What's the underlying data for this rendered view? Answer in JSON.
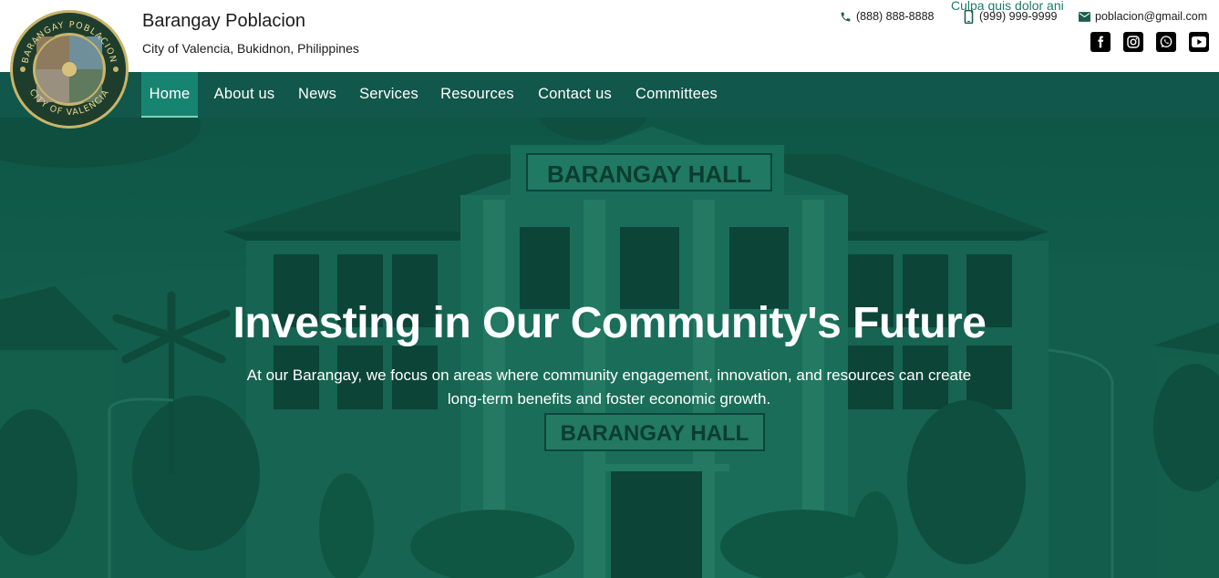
{
  "header": {
    "title": "Barangay Poblacion",
    "subtitle": "City of Valencia, Bukidnon, Philippines",
    "tagline": "Culpa quis dolor ani",
    "logo": {
      "ring_text_top": "BARANGAY POBLACION",
      "ring_text_bottom": "CITY OF VALENCIA"
    },
    "contacts": [
      {
        "icon": "phone-icon",
        "text": "(888) 888-8888"
      },
      {
        "icon": "mobile-phone-icon",
        "text": "(999) 999-9999"
      },
      {
        "icon": "envelope-icon",
        "text": "poblacion@gmail.com"
      }
    ],
    "social": [
      "facebook-icon",
      "instagram-icon",
      "whatsapp-icon",
      "youtube-icon"
    ]
  },
  "nav": {
    "items": [
      {
        "label": "Home",
        "active": true
      },
      {
        "label": "About us"
      },
      {
        "label": "News"
      },
      {
        "label": "Services"
      },
      {
        "label": "Resources"
      },
      {
        "label": "Contact us"
      },
      {
        "label": "Committees"
      }
    ]
  },
  "hero": {
    "title": "Investing in Our Community's Future",
    "text": "At our Barangay, we focus on areas where community engagement, innovation, and resources can create long-term benefits and foster economic growth.",
    "building_sign_top": "BARANGAY HALL",
    "building_sign_bottom": "BARANGAY HALL"
  },
  "colors": {
    "nav_bg": "#11574b",
    "nav_active": "#178471",
    "hero_tint": "#14604f",
    "accent_text": "#1e7a68"
  }
}
